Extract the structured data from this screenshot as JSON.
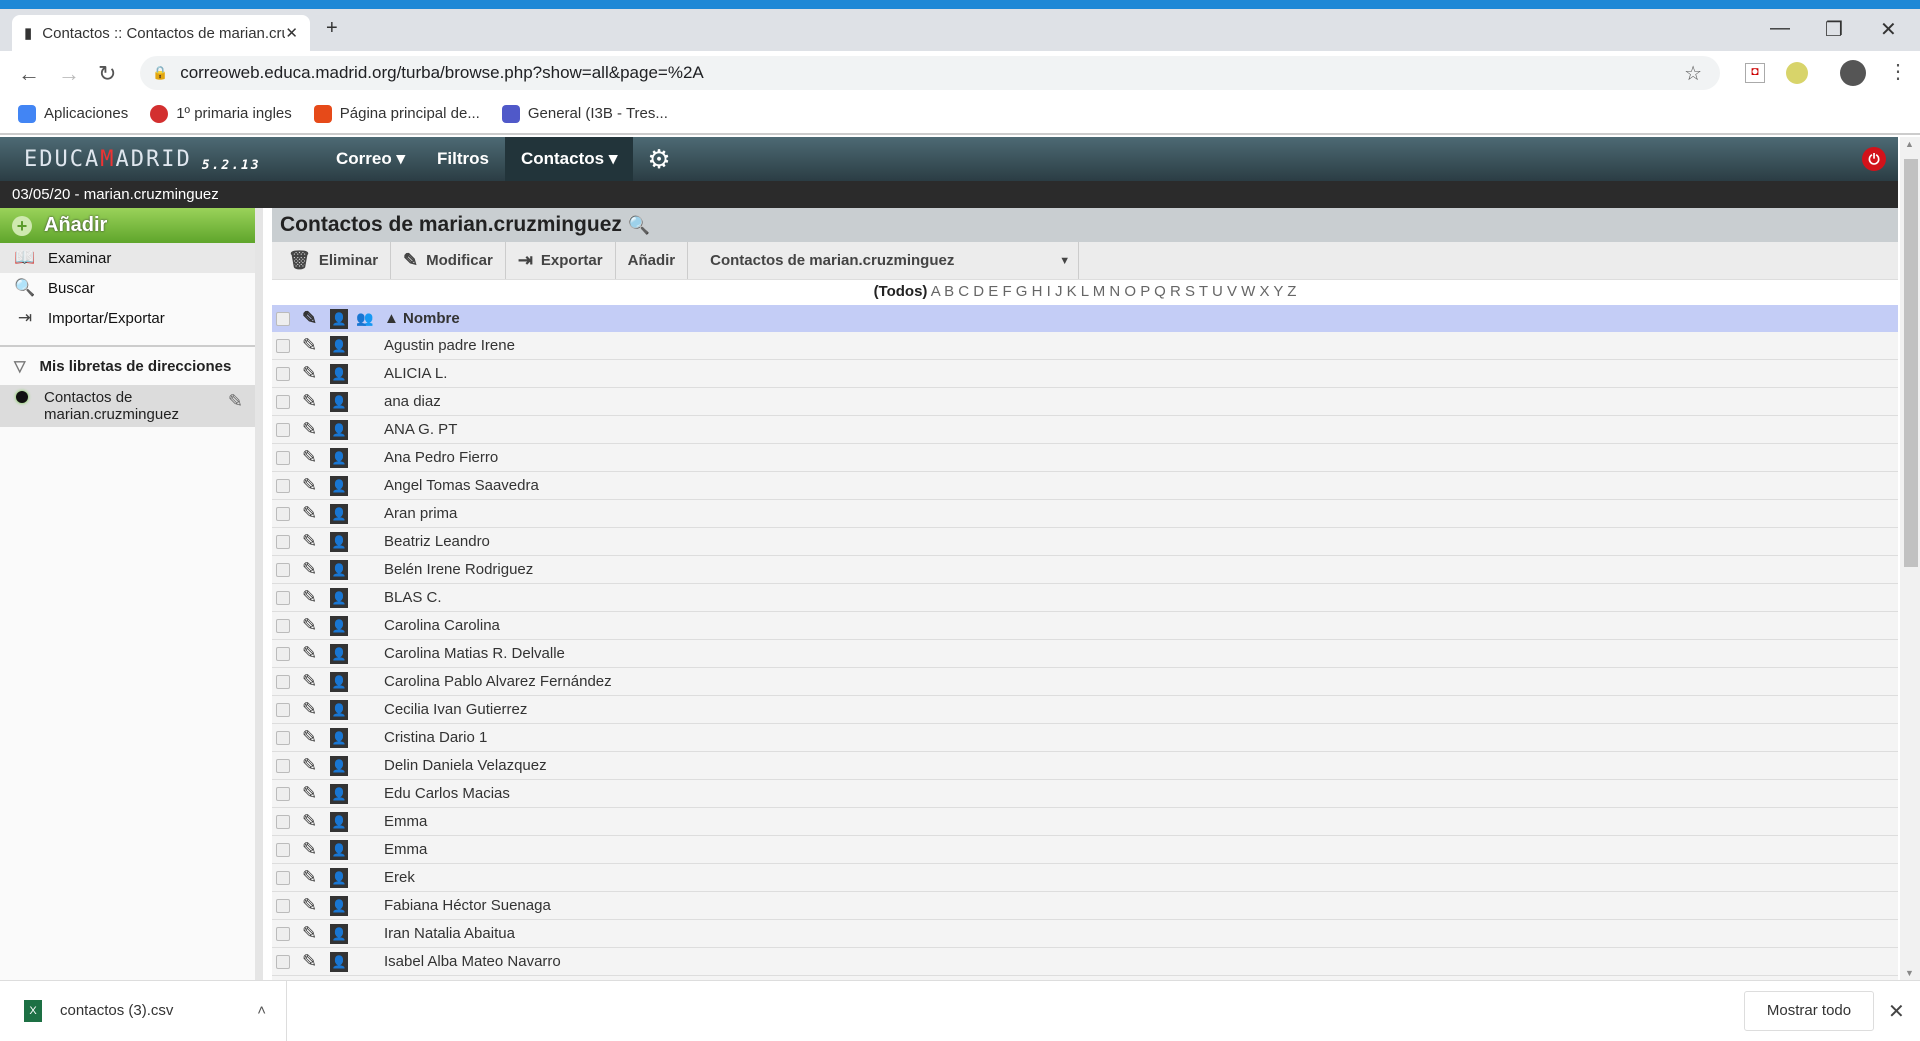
{
  "browser": {
    "tab_title": "Contactos :: Contactos de marian.cruzminguez",
    "url": "correoweb.educa.madrid.org/turba/browse.php?show=all&page=%2A",
    "bookmarks": [
      {
        "label": "Aplicaciones",
        "color": "#4285f4"
      },
      {
        "label": "1º primaria ingles",
        "color": "#d32f2f"
      },
      {
        "label": "Página principal de...",
        "color": "#e64a19"
      },
      {
        "label": "General (I3B - Tres...",
        "color": "#5059c9"
      }
    ]
  },
  "app": {
    "logo": "EDUCAMADRID",
    "version": "5.2.13",
    "menu": [
      "Correo",
      "Filtros",
      "Contactos"
    ],
    "date_user": "03/05/20 - marian.cruzminguez"
  },
  "sidebar": {
    "add": "Añadir",
    "items": [
      "Examinar",
      "Buscar",
      "Importar/Exportar"
    ],
    "section": "Mis libretas de direcciones",
    "book_line1": "Contactos de",
    "book_line2": "marian.cruzminguez"
  },
  "main": {
    "title": "Contactos de marian.cruzminguez",
    "toolbar": {
      "delete": "Eliminar",
      "modify": "Modificar",
      "export": "Exportar",
      "add": "Añadir",
      "select": "Contactos de marian.cruzminguez"
    },
    "letters_all": "(Todos)",
    "letters": "A B C D E F G H I J K L M N O P Q R S T U V W X Y Z",
    "column": "▲ Nombre",
    "contacts": [
      "Agustin padre Irene",
      "ALICIA L.",
      "ana diaz",
      "ANA G. PT",
      "Ana Pedro Fierro",
      "Angel Tomas Saavedra",
      "Aran prima",
      "Beatriz Leandro",
      "Belén Irene Rodriguez",
      "BLAS C.",
      "Carolina Carolina",
      "Carolina Matias R. Delvalle",
      "Carolina Pablo Alvarez Fernández",
      "Cecilia Ivan Gutierrez",
      "Cristina Dario 1",
      "Delin Daniela Velazquez",
      "Edu Carlos Macias",
      "Emma",
      "Emma",
      "Erek",
      "Fabiana Héctor Suenaga",
      "Iran Natalia Abaitua",
      "Isabel Alba Mateo Navarro"
    ]
  },
  "downloads": {
    "file": "contactos (3).csv",
    "show_all": "Mostrar todo"
  }
}
